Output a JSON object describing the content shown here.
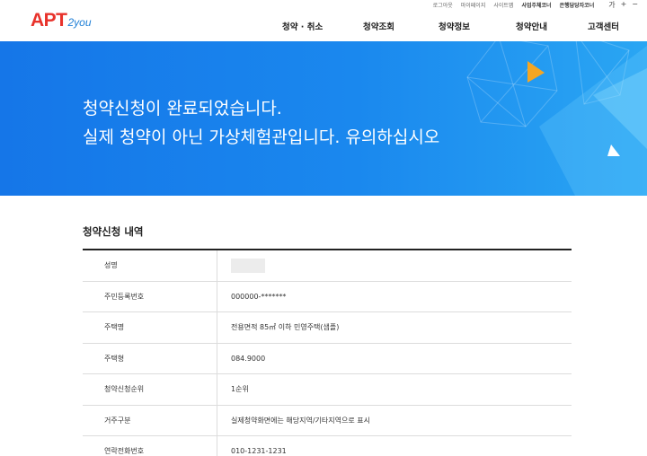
{
  "header": {
    "logo_main": "APT",
    "logo_sub": "2you",
    "util_links": [
      "로그아웃",
      "마이페이지",
      "사이트맵"
    ],
    "util_bold_links": [
      "사업주체코너",
      "은행담당자코너"
    ],
    "font_controls": [
      "가",
      "+",
      "−"
    ],
    "menu": [
      "청약 · 취소",
      "청약조회",
      "청약정보",
      "청약안내",
      "고객센터"
    ]
  },
  "banner": {
    "line1": "청약신청이 완료되었습니다.",
    "line2": "실제 청약이 아닌 가상체험관입니다. 유의하십시오"
  },
  "section": {
    "title": "청약신청 내역"
  },
  "table": {
    "rows": [
      {
        "label": "성명",
        "value": ""
      },
      {
        "label": "주민등록번호",
        "value": "000000-*******"
      },
      {
        "label": "주택명",
        "value": "전용면적 85㎡ 이하 민영주택(샘플)"
      },
      {
        "label": "주택형",
        "value": "084.9000"
      },
      {
        "label": "청약신청순위",
        "value": "1순위"
      },
      {
        "label": "거주구분",
        "value": "실제청약화면에는 해당지역/기타지역으로 표시"
      },
      {
        "label": "연락전화번호",
        "value": "010-1231-1231"
      }
    ]
  },
  "colors": {
    "banner_blue": "#1a88ee",
    "logo_red": "#e8322b",
    "accent_orange": "#f5a623"
  }
}
